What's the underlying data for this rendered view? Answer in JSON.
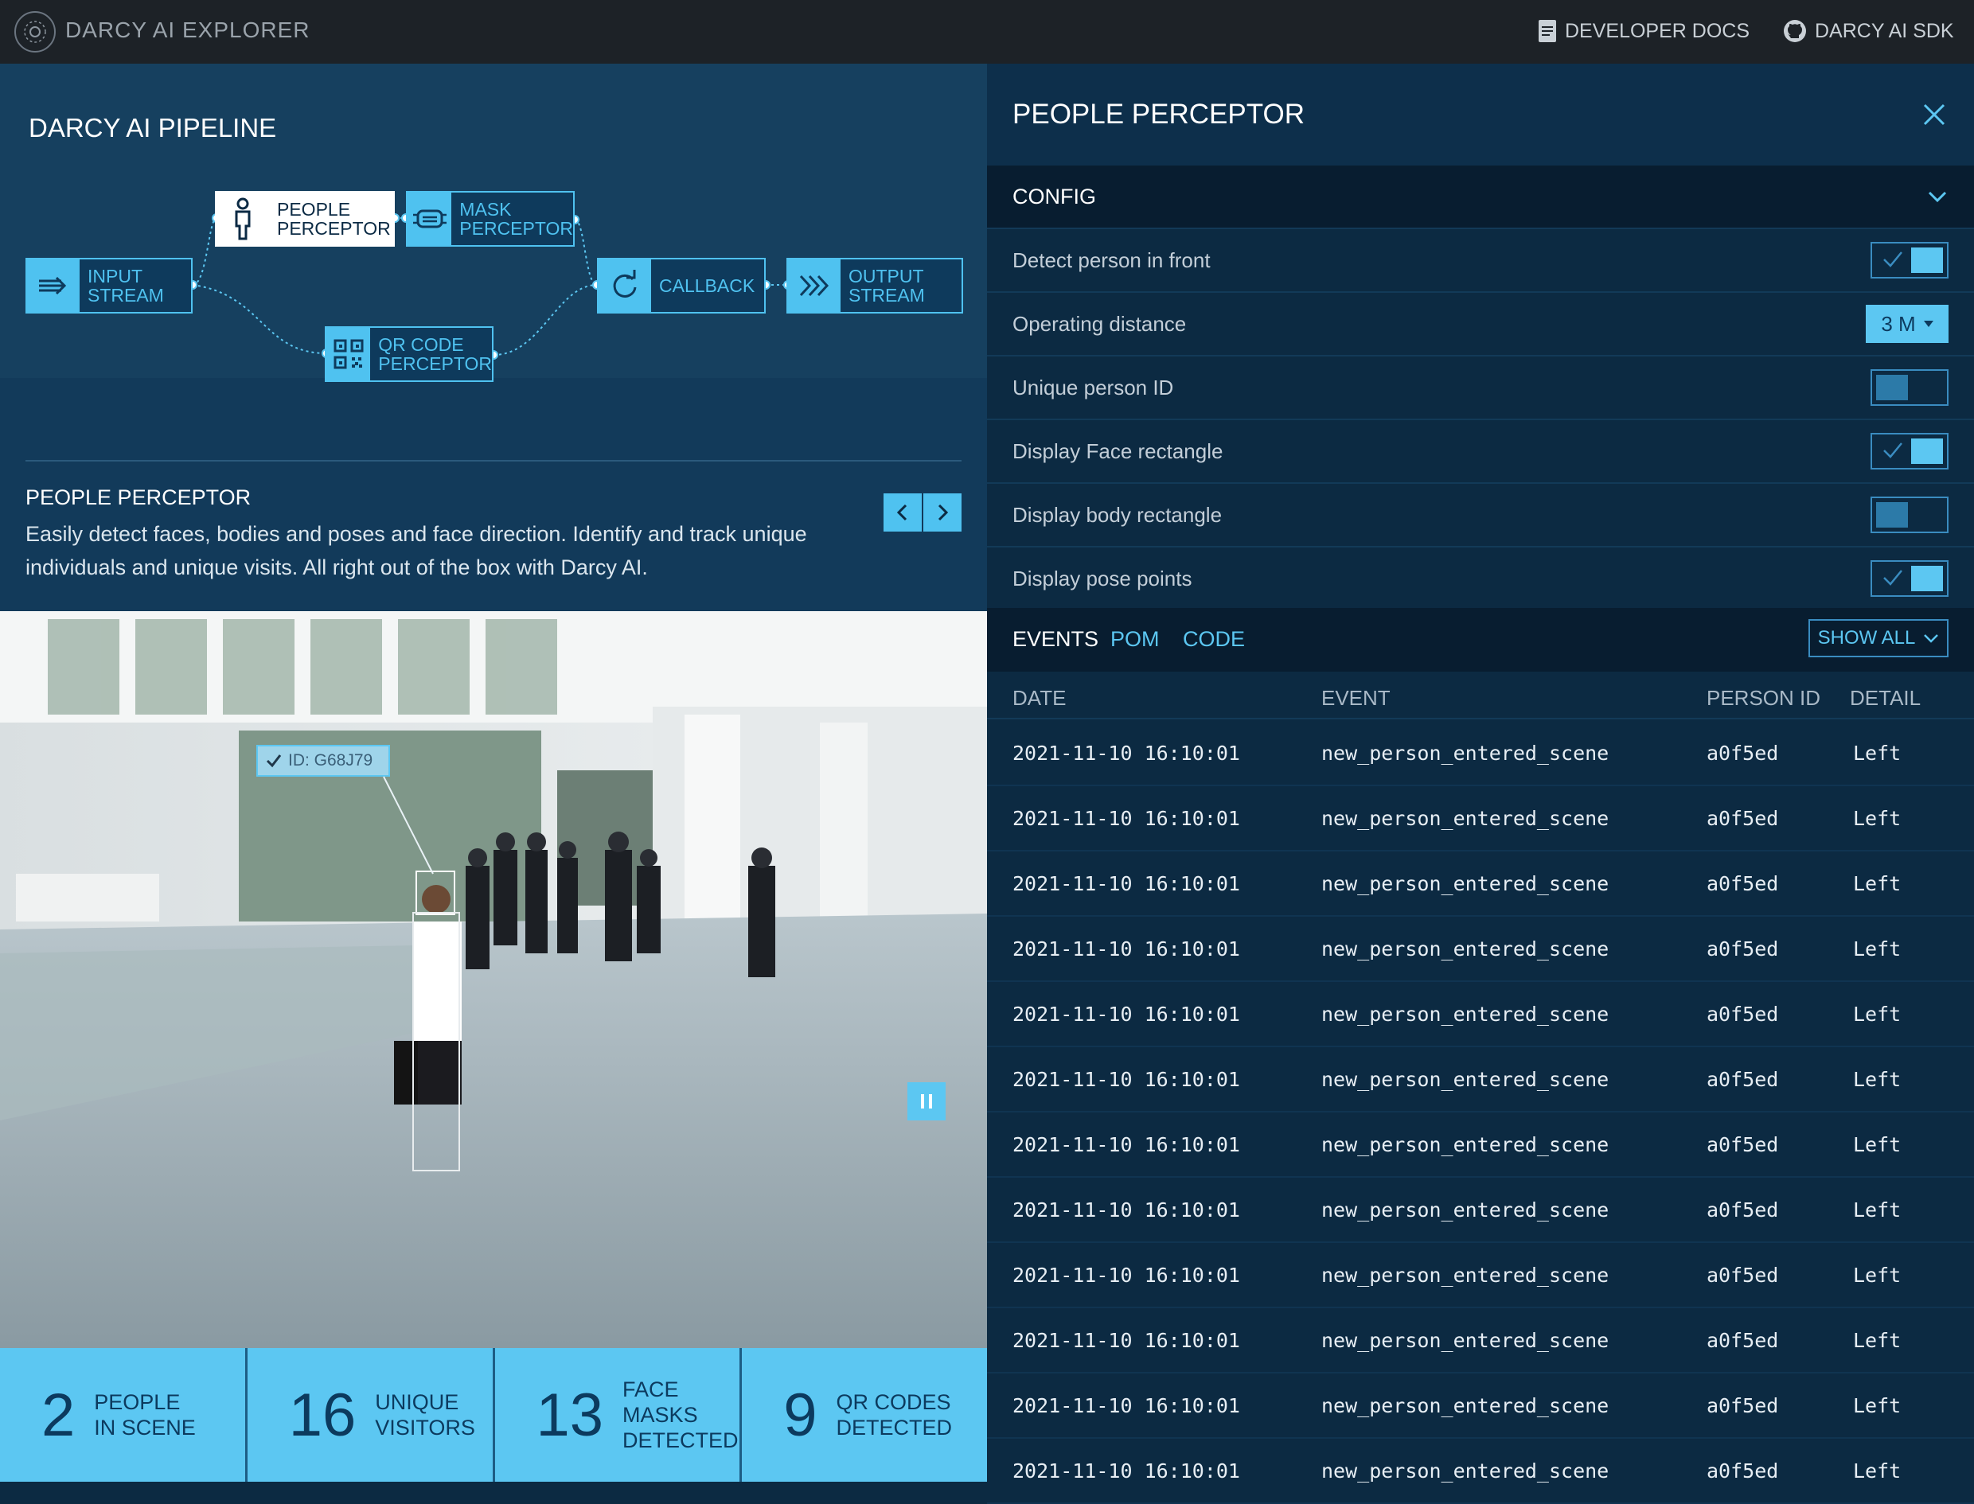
{
  "header": {
    "app_title": "DARCY AI EXPLORER",
    "docs_label": "DEVELOPER DOCS",
    "sdk_label": "DARCY AI SDK"
  },
  "pipeline": {
    "title": "DARCY AI PIPELINE",
    "nodes": {
      "input": [
        "INPUT",
        "STREAM"
      ],
      "people": [
        "PEOPLE",
        "PERCEPTOR"
      ],
      "mask": [
        "MASK",
        "PERCEPTOR"
      ],
      "qr": [
        "QR CODE",
        "PERCEPTOR"
      ],
      "callback": [
        "CALLBACK"
      ],
      "output": [
        "OUTPUT",
        "STREAM"
      ]
    },
    "selected": "people"
  },
  "description": {
    "title": "PEOPLE PERCEPTOR",
    "text": "Easily detect faces, bodies and poses and face direction.  Identify and track unique individuals and unique visits. All right out of the box with Darcy AI."
  },
  "video": {
    "id_tag": "ID: G68J79"
  },
  "stats": [
    {
      "value": "2",
      "label1": "PEOPLE",
      "label2": "IN SCENE"
    },
    {
      "value": "16",
      "label1": "UNIQUE",
      "label2": "VISITORS"
    },
    {
      "value": "13",
      "label1": "FACE MASKS",
      "label2": "DETECTED"
    },
    {
      "value": "9",
      "label1": "QR CODES",
      "label2": "DETECTED"
    }
  ],
  "panel": {
    "title": "PEOPLE PERCEPTOR",
    "config_label": "CONFIG",
    "config": [
      {
        "label": "Detect person in front",
        "type": "toggle",
        "on": true
      },
      {
        "label": "Operating distance",
        "type": "select",
        "value": "3 M"
      },
      {
        "label": "Unique person ID",
        "type": "toggle",
        "on": false
      },
      {
        "label": "Display Face rectangle",
        "type": "toggle",
        "on": true
      },
      {
        "label": "Display body rectangle",
        "type": "toggle",
        "on": false
      },
      {
        "label": "Display pose points",
        "type": "toggle",
        "on": true
      }
    ],
    "tabs": [
      "EVENTS",
      "POM",
      "CODE"
    ],
    "active_tab": "EVENTS",
    "filter": "SHOW ALL",
    "columns": [
      "DATE",
      "EVENT",
      "PERSON ID",
      "DETAIL"
    ],
    "rows": [
      [
        "2021-11-10 16:10:01",
        "new_person_entered_scene",
        "a0f5ed",
        "Left"
      ],
      [
        "2021-11-10 16:10:01",
        "new_person_entered_scene",
        "a0f5ed",
        "Left"
      ],
      [
        "2021-11-10 16:10:01",
        "new_person_entered_scene",
        "a0f5ed",
        "Left"
      ],
      [
        "2021-11-10 16:10:01",
        "new_person_entered_scene",
        "a0f5ed",
        "Left"
      ],
      [
        "2021-11-10 16:10:01",
        "new_person_entered_scene",
        "a0f5ed",
        "Left"
      ],
      [
        "2021-11-10 16:10:01",
        "new_person_entered_scene",
        "a0f5ed",
        "Left"
      ],
      [
        "2021-11-10 16:10:01",
        "new_person_entered_scene",
        "a0f5ed",
        "Left"
      ],
      [
        "2021-11-10 16:10:01",
        "new_person_entered_scene",
        "a0f5ed",
        "Left"
      ],
      [
        "2021-11-10 16:10:01",
        "new_person_entered_scene",
        "a0f5ed",
        "Left"
      ],
      [
        "2021-11-10 16:10:01",
        "new_person_entered_scene",
        "a0f5ed",
        "Left"
      ],
      [
        "2021-11-10 16:10:01",
        "new_person_entered_scene",
        "a0f5ed",
        "Left"
      ],
      [
        "2021-11-10 16:10:01",
        "new_person_entered_scene",
        "a0f5ed",
        "Left"
      ]
    ]
  },
  "colors": {
    "accent": "#5cc7f2",
    "topbar": "#1d2227",
    "panel_bg": "#0c2a42"
  }
}
